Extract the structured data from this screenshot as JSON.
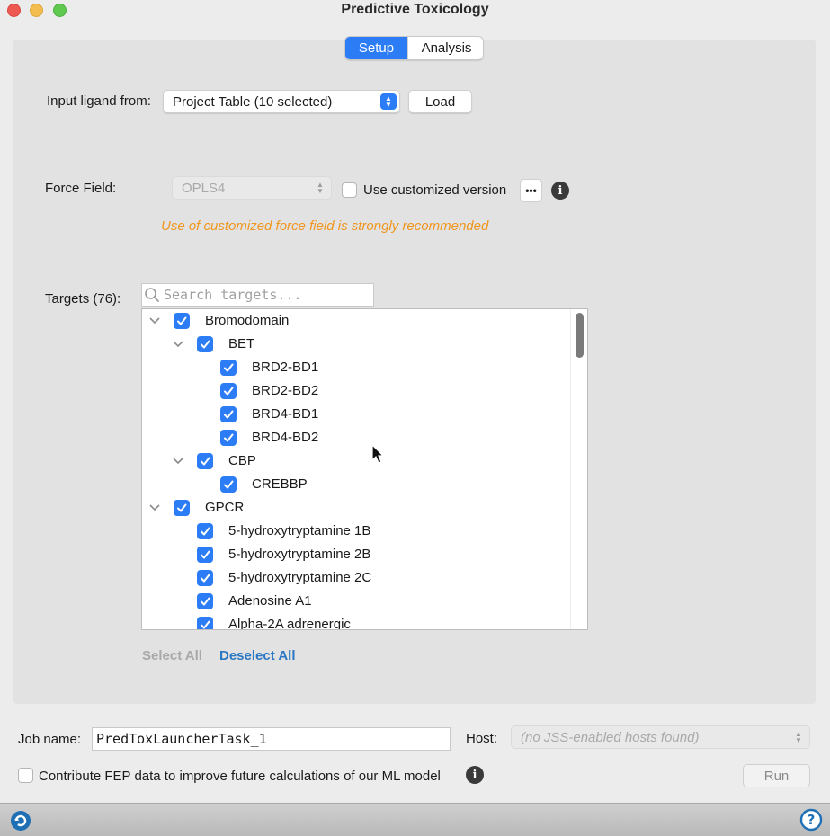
{
  "window": {
    "title": "Predictive Toxicology"
  },
  "tabs": [
    {
      "label": "Setup",
      "active": true
    },
    {
      "label": "Analysis",
      "active": false
    }
  ],
  "ligand": {
    "label": "Input ligand from:",
    "value": "Project Table (10 selected)",
    "load_button": "Load"
  },
  "force_field": {
    "label": "Force Field:",
    "value": "OPLS4",
    "custom_label": "Use customized version",
    "custom_checked": false,
    "options_button": "•••",
    "warning": "Use of customized force field is strongly recommended"
  },
  "targets": {
    "label": "Targets (76):",
    "search_placeholder": "Search targets...",
    "rows": [
      {
        "label": "Bromodomain",
        "level": 0,
        "expander": true
      },
      {
        "label": "BET",
        "level": 1,
        "expander": true
      },
      {
        "label": "BRD2-BD1",
        "level": 2,
        "expander": false
      },
      {
        "label": "BRD2-BD2",
        "level": 2,
        "expander": false
      },
      {
        "label": "BRD4-BD1",
        "level": 2,
        "expander": false
      },
      {
        "label": "BRD4-BD2",
        "level": 2,
        "expander": false
      },
      {
        "label": "CBP",
        "level": 1,
        "expander": true
      },
      {
        "label": "CREBBP",
        "level": 2,
        "expander": false
      },
      {
        "label": "GPCR",
        "level": 0,
        "expander": true
      },
      {
        "label": "5-hydroxytryptamine 1B",
        "level": 1,
        "expander": false
      },
      {
        "label": "5-hydroxytryptamine 2B",
        "level": 1,
        "expander": false
      },
      {
        "label": "5-hydroxytryptamine 2C",
        "level": 1,
        "expander": false
      },
      {
        "label": "Adenosine A1",
        "level": 1,
        "expander": false
      },
      {
        "label": "Alpha-2A adrenergic",
        "level": 1,
        "expander": false
      }
    ],
    "select_all": "Select All",
    "deselect_all": "Deselect All"
  },
  "job": {
    "name_label": "Job name:",
    "name_value": "PredToxLauncherTask_1",
    "host_label": "Host:",
    "host_value": "(no JSS-enabled hosts found)",
    "contribute_label": "Contribute FEP data to improve future calculations of our ML model",
    "run_button": "Run"
  },
  "colors": {
    "accent": "#2c7cf6",
    "warning": "#f0961e",
    "link": "#2b78c2"
  }
}
